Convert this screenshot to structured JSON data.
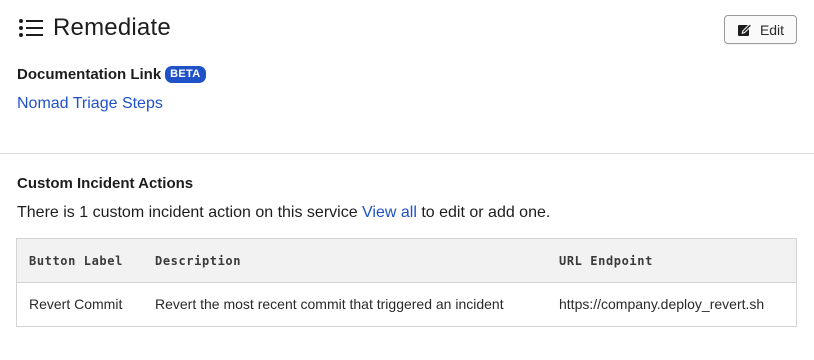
{
  "header": {
    "title": "Remediate",
    "title_icon": "list-icon",
    "edit_label": "Edit",
    "edit_icon": "edit-icon"
  },
  "documentation": {
    "label": "Documentation Link",
    "badge": "BETA",
    "link_text": "Nomad Triage Steps"
  },
  "custom_actions": {
    "title": "Custom Incident Actions",
    "desc_prefix": "There is 1 custom incident action on this service ",
    "desc_link": "View all",
    "desc_suffix": " to edit or add one.",
    "columns": [
      "Button Label",
      "Description",
      "URL Endpoint"
    ],
    "rows": [
      {
        "button_label": "Revert Commit",
        "description": "Revert the most recent commit that triggered an incident",
        "url": "https://company.deploy_revert.sh"
      }
    ]
  },
  "colors": {
    "accent": "#1f52c7",
    "text": "#1d1d1d",
    "table_header_bg": "#f2f2f2",
    "border": "#d3d3d3"
  }
}
